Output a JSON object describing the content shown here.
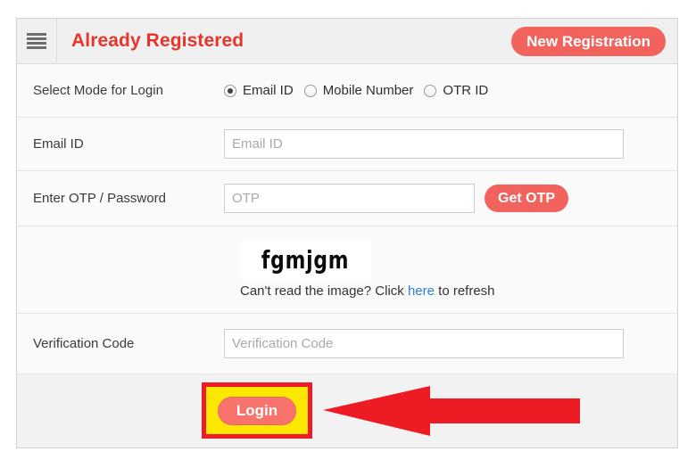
{
  "header": {
    "menu_icon": "hamburger-icon",
    "title": "Already Registered",
    "new_registration_label": "New Registration"
  },
  "form": {
    "mode_row": {
      "label": "Select Mode for Login",
      "options": [
        {
          "label": "Email ID",
          "selected": true
        },
        {
          "label": "Mobile Number",
          "selected": false
        },
        {
          "label": "OTR ID",
          "selected": false
        }
      ]
    },
    "email_row": {
      "label": "Email ID",
      "placeholder": "Email ID",
      "value": ""
    },
    "otp_row": {
      "label": "Enter OTP / Password",
      "placeholder": "OTP",
      "value": "",
      "button_label": "Get OTP"
    },
    "captcha_row": {
      "captcha_text": "fgmjgm",
      "hint_prefix": "Can't read the image? Click ",
      "hint_link": "here",
      "hint_suffix": " to refresh"
    },
    "verification_row": {
      "label": "Verification Code",
      "placeholder": "Verification Code",
      "value": ""
    }
  },
  "footer": {
    "login_label": "Login"
  },
  "annotation": {
    "highlight_box_fill": "#ffe800",
    "highlight_box_border": "#ed1c24",
    "arrow_color": "#ed1c24",
    "arrow_direction": "left"
  },
  "colors": {
    "brand_red": "#e8342a",
    "button_coral": "#f2635e",
    "link_blue": "#2b7fd4",
    "card_border": "#d4d4d4",
    "row_background": "#fafafa",
    "header_background": "#f0f0f0",
    "footer_background": "#f2f2f2"
  }
}
